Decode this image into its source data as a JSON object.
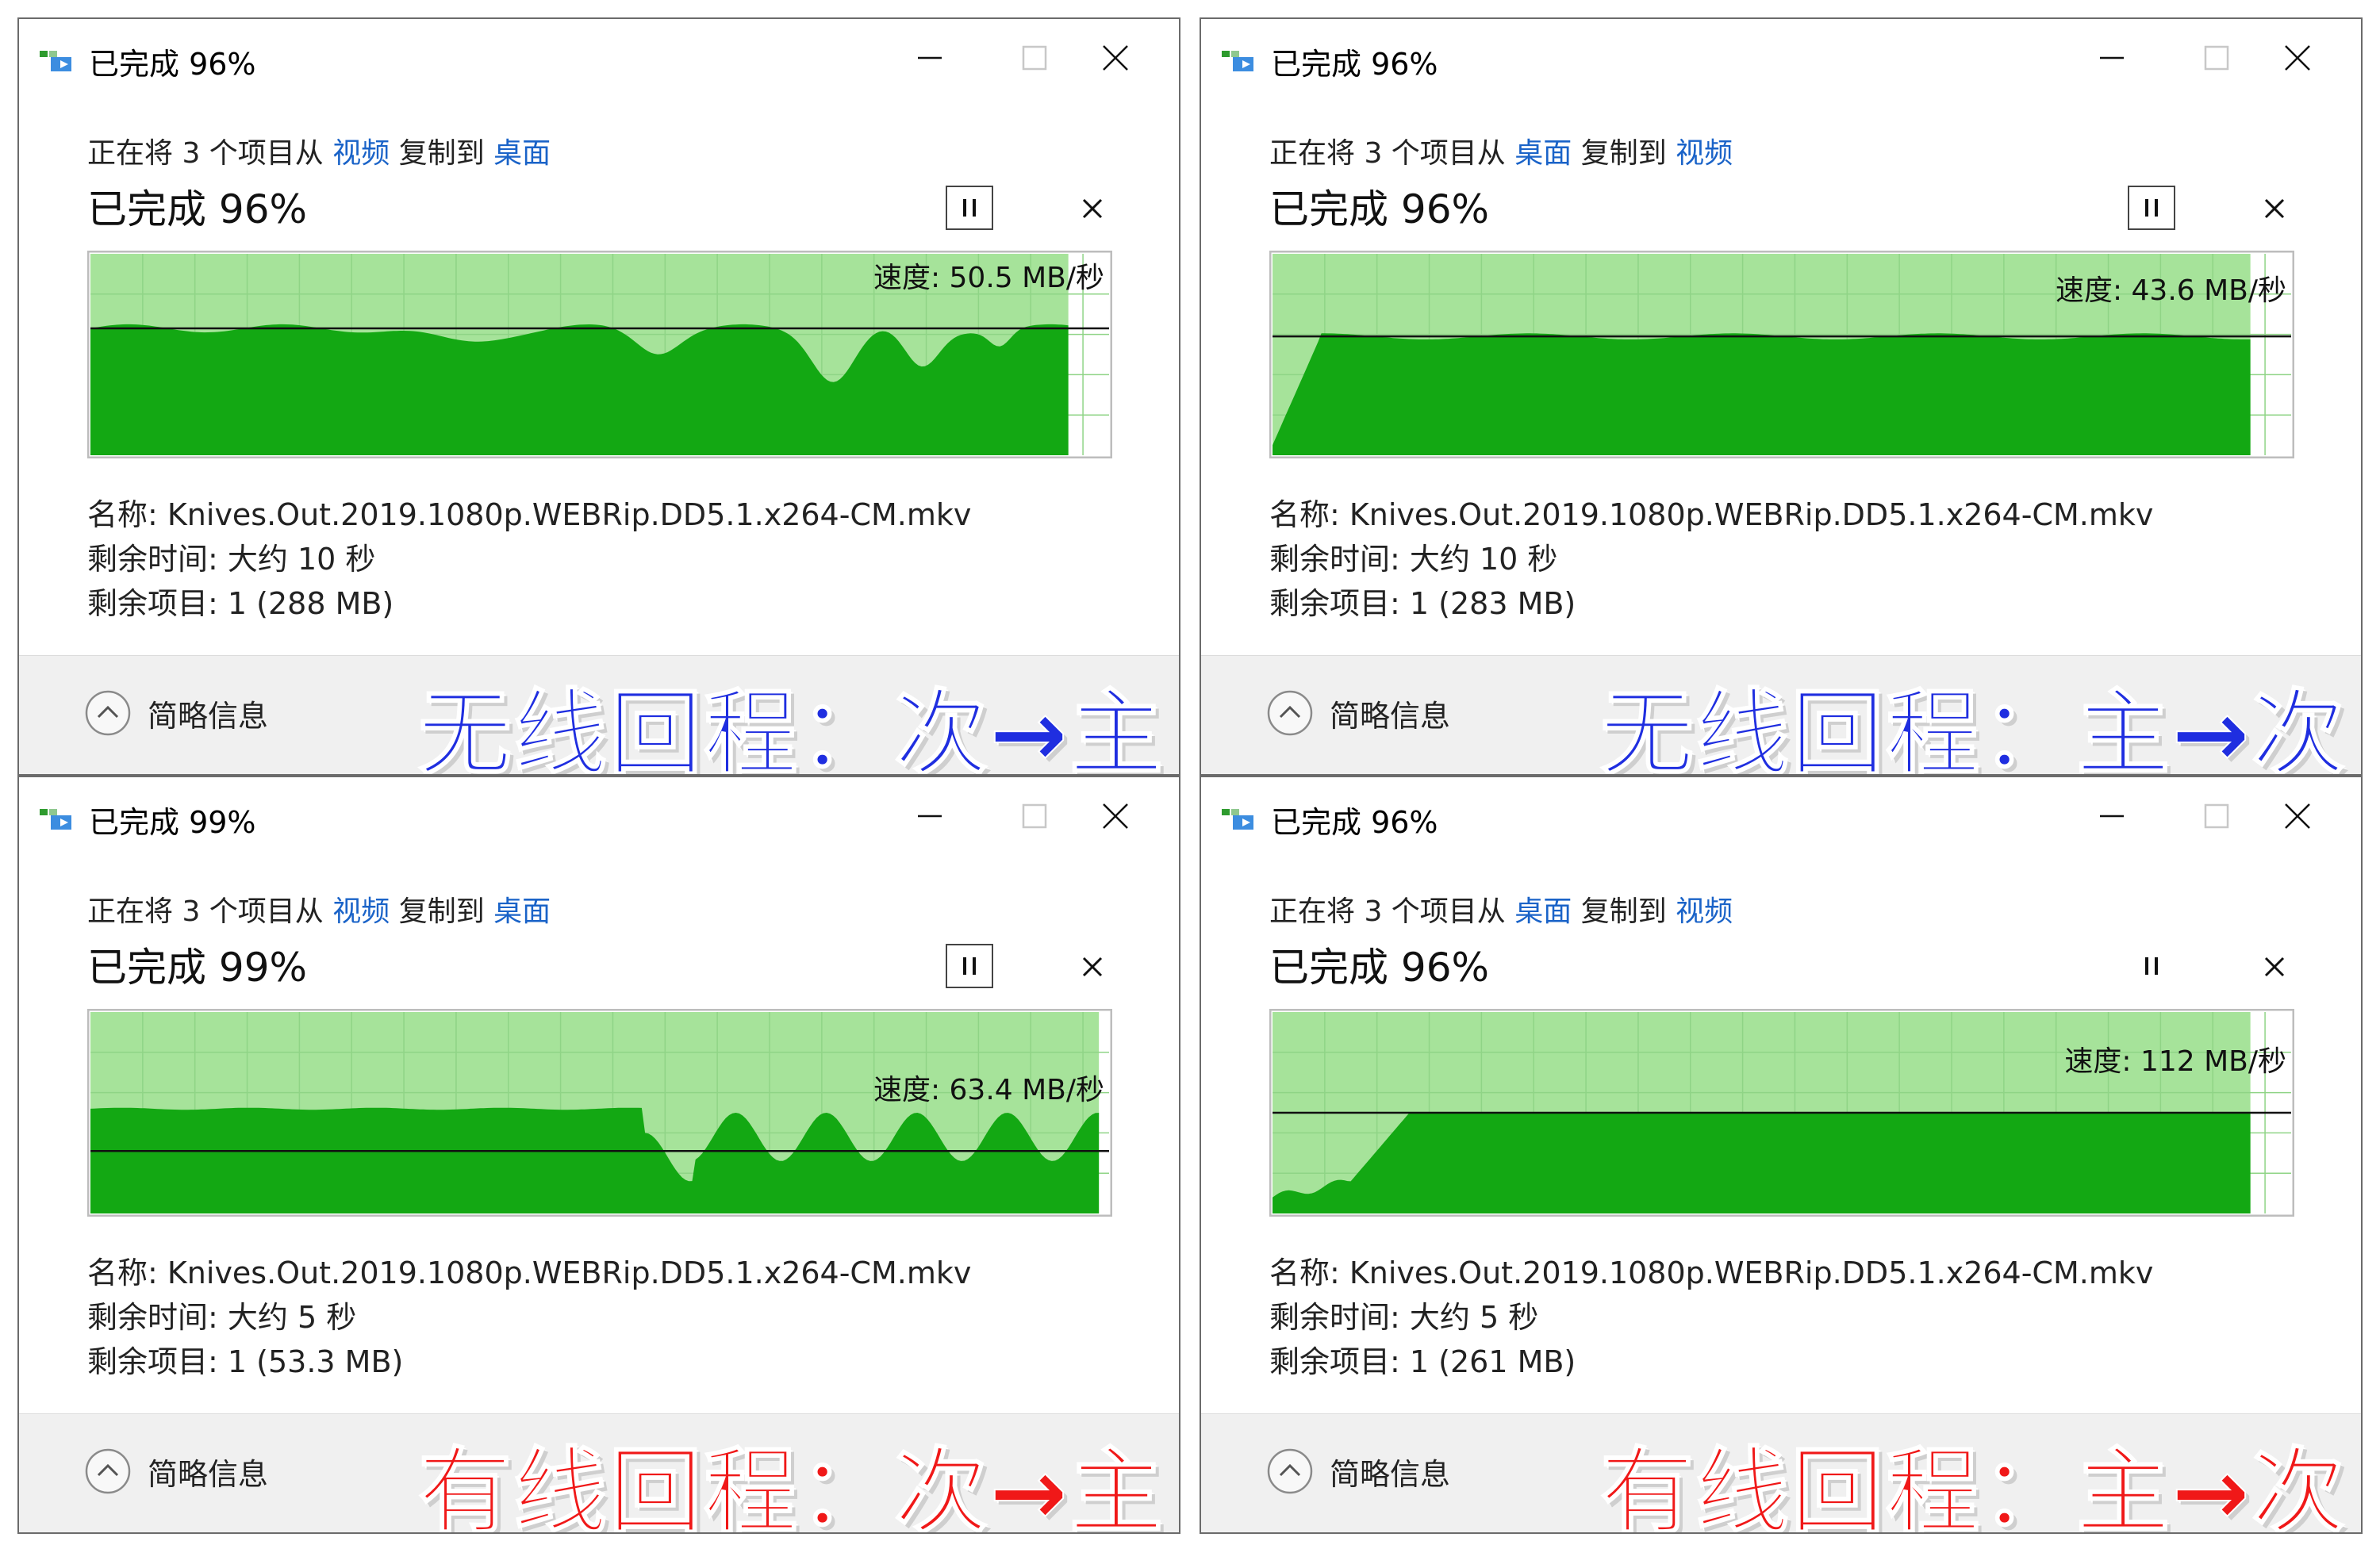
{
  "dialogs": [
    {
      "title": "已完成 96%",
      "desc_prefix": "正在将 3 个项目从 ",
      "source": "视频",
      "desc_mid": " 复制到 ",
      "dest": "桌面",
      "progress_title": "已完成 96%",
      "progress": 0.96,
      "speed_label": "速度: 50.5 MB/秒",
      "speed_mbps": 50.5,
      "pause_boxed": true,
      "name_line": "名称: Knives.Out.2019.1080p.WEBRip.DD5.1.x264-CM.mkv",
      "time_line": "剩余时间: 大约 10 秒",
      "items_line": "剩余项目: 1 (288 MB)",
      "collapse_label": "简略信息",
      "caption": "无线回程：次→主",
      "caption_color": "#1f2ee0"
    },
    {
      "title": "已完成 96%",
      "desc_prefix": "正在将 3 个项目从 ",
      "source": "桌面",
      "desc_mid": " 复制到 ",
      "dest": "视频",
      "progress_title": "已完成 96%",
      "progress": 0.96,
      "speed_label": "速度: 43.6 MB/秒",
      "speed_mbps": 43.6,
      "pause_boxed": true,
      "name_line": "名称: Knives.Out.2019.1080p.WEBRip.DD5.1.x264-CM.mkv",
      "time_line": "剩余时间: 大约 10 秒",
      "items_line": "剩余项目: 1 (283 MB)",
      "collapse_label": "简略信息",
      "caption": "无线回程：主→次",
      "caption_color": "#1f2ee0"
    },
    {
      "title": "已完成 99%",
      "desc_prefix": "正在将 3 个项目从 ",
      "source": "视频",
      "desc_mid": " 复制到 ",
      "dest": "桌面",
      "progress_title": "已完成 99%",
      "progress": 0.99,
      "speed_label": "速度: 63.4 MB/秒",
      "speed_mbps": 63.4,
      "pause_boxed": true,
      "name_line": "名称: Knives.Out.2019.1080p.WEBRip.DD5.1.x264-CM.mkv",
      "time_line": "剩余时间: 大约 5 秒",
      "items_line": "剩余项目: 1 (53.3 MB)",
      "collapse_label": "简略信息",
      "caption": "有线回程：次→主",
      "caption_color": "#f01818"
    },
    {
      "title": "已完成 96%",
      "desc_prefix": "正在将 3 个项目从 ",
      "source": "桌面",
      "desc_mid": " 复制到 ",
      "dest": "视频",
      "progress_title": "已完成 96%",
      "progress": 0.96,
      "speed_label": "速度: 112 MB/秒",
      "speed_mbps": 112,
      "pause_boxed": false,
      "name_line": "名称: Knives.Out.2019.1080p.WEBRip.DD5.1.x264-CM.mkv",
      "time_line": "剩余时间: 大约 5 秒",
      "items_line": "剩余项目: 1 (261 MB)",
      "collapse_label": "简略信息",
      "caption": "有线回程：主→次",
      "caption_color": "#f01818"
    }
  ],
  "colors": {
    "graph_fill": "#13a813",
    "graph_bg": "#a6e39a",
    "graph_grid": "#8fd486",
    "link": "#1a63c8"
  },
  "icons": {
    "app": "copy-arrow-icon",
    "minimize": "minimize-icon",
    "maximize": "maximize-icon",
    "close": "close-icon",
    "pause": "pause-icon",
    "cancel": "cancel-icon",
    "collapse": "chevron-up-circle-icon"
  }
}
